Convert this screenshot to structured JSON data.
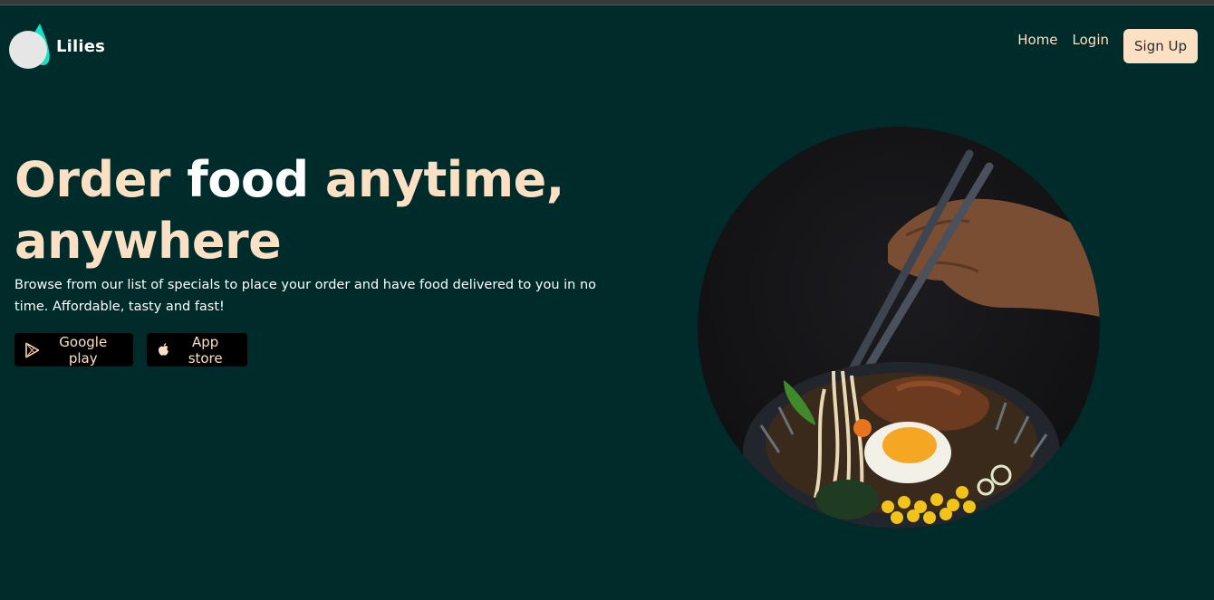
{
  "header": {
    "brand_name": "Lilies",
    "nav": {
      "home": "Home",
      "login": "Login",
      "signup": "Sign Up"
    }
  },
  "hero": {
    "title_part1": "Order ",
    "title_part2": "food",
    "title_part3": " anytime, anywhere",
    "description": "Browse from our list of specials to place your order and have food delivered to you in no time. Affordable, tasty and fast!",
    "buttons": {
      "google_play": "Google play",
      "app_store": "App store"
    }
  },
  "icons": {
    "logo": "lilies-drop-logo",
    "google_play": "google-play-icon",
    "app_store": "apple-icon"
  },
  "colors": {
    "background": "#002b2b",
    "accent": "#fbe0c4",
    "logo_teal": "#14e0c8",
    "button_bg": "#000000"
  }
}
